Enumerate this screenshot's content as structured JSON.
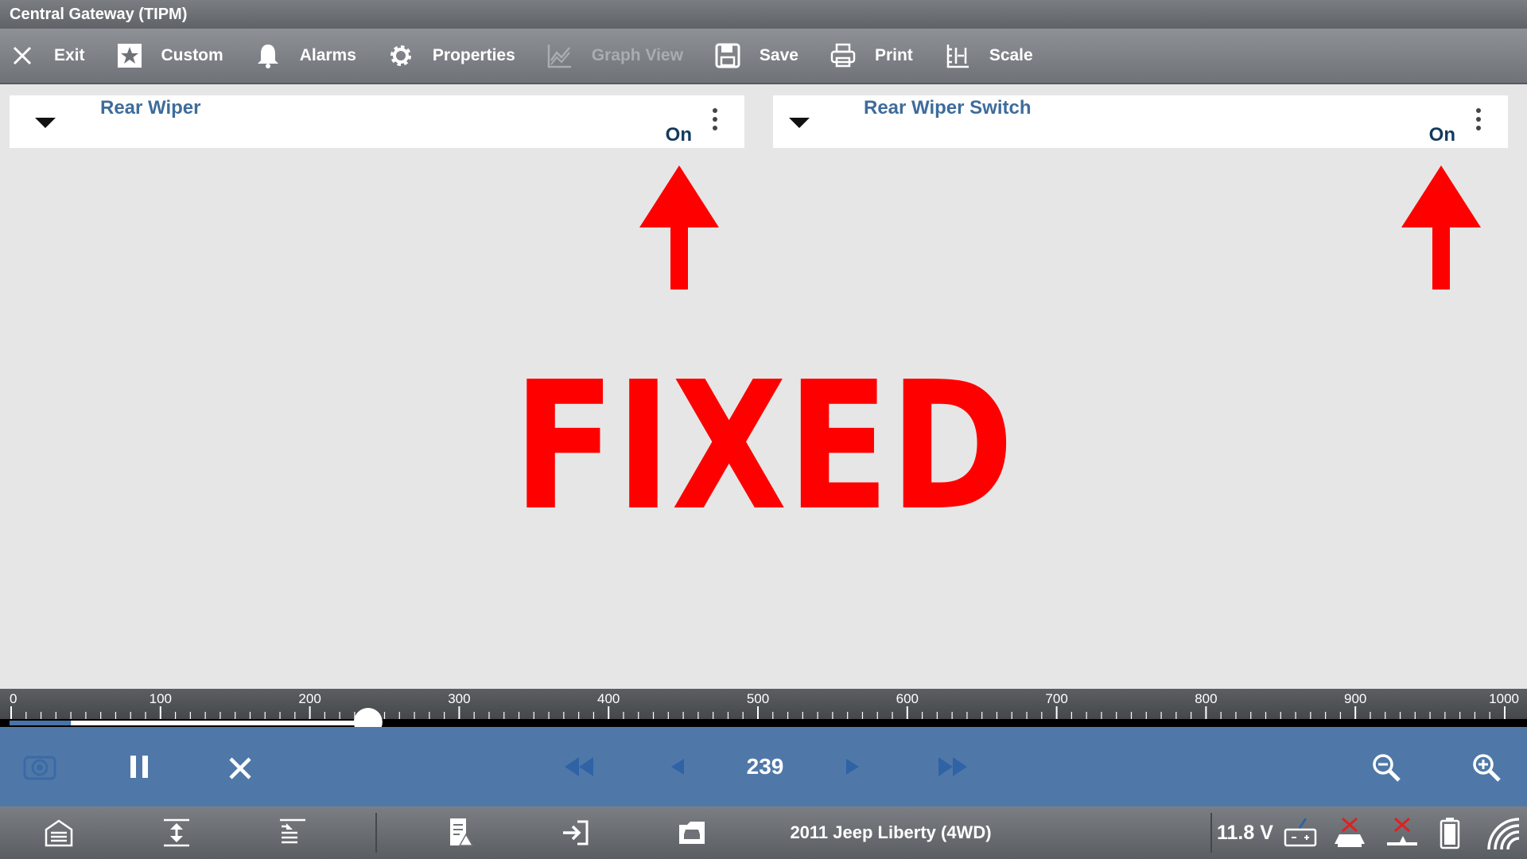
{
  "window": {
    "title": "Central Gateway (TIPM)"
  },
  "toolbar": {
    "items": [
      {
        "label": "Exit",
        "icon": "close-icon"
      },
      {
        "label": "Custom",
        "icon": "star-icon"
      },
      {
        "label": "Alarms",
        "icon": "bell-icon"
      },
      {
        "label": "Properties",
        "icon": "gear-icon"
      },
      {
        "label": "Graph View",
        "icon": "graph-icon",
        "disabled": true
      },
      {
        "label": "Save",
        "icon": "save-icon"
      },
      {
        "label": "Print",
        "icon": "printer-icon"
      },
      {
        "label": "Scale",
        "icon": "scale-icon"
      }
    ]
  },
  "panels": [
    {
      "name": "Rear Wiper",
      "value": "On"
    },
    {
      "name": "Rear Wiper Switch",
      "value": "On"
    }
  ],
  "overlay": {
    "text": "FIXED",
    "color": "#ff0000",
    "arrow_icon": "red-up-arrow-icon"
  },
  "timeline": {
    "ticks": [
      "0",
      "100",
      "200",
      "300",
      "400",
      "500",
      "600",
      "700",
      "800",
      "900",
      "1000"
    ],
    "min": 0,
    "max": 1000,
    "position": 239
  },
  "playback": {
    "frame": "239",
    "icons": [
      "snapshot-icon",
      "pause-icon",
      "stop-icon",
      "skip-back-icon",
      "step-back-icon",
      "step-forward-icon",
      "skip-forward-icon",
      "zoom-out-icon",
      "zoom-in-icon"
    ]
  },
  "status": {
    "vehicle": "2011 Jeep Liberty (4WD)",
    "voltage": "11.8 V",
    "icons": [
      "home-icon",
      "expand-icon",
      "collapse-icon",
      "report-icon",
      "exit-vehicle-icon",
      "vehicle-icon",
      "battery-link-icon",
      "vci-disconnected-icon",
      "dongle-disconnected-icon",
      "battery-icon",
      "wifi-icon"
    ]
  },
  "colors": {
    "accent": "#4f78a8",
    "panel_title": "#3e6c9c",
    "panel_value": "#123a5e",
    "overlay_red": "#ff0000"
  }
}
